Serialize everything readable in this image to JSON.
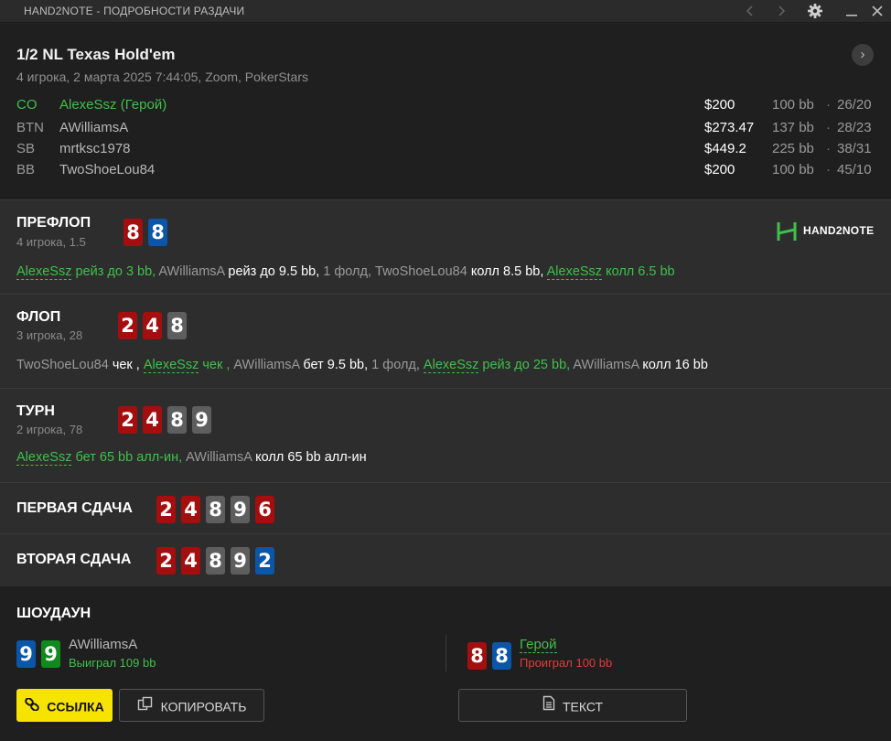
{
  "titlebar": {
    "title": "HAND2NOTE - ПОДРОБНОСТИ РАЗДАЧИ",
    "icons": [
      "chevron-left-icon",
      "chevron-right-icon",
      "gear-icon",
      "minimize-icon",
      "close-icon"
    ]
  },
  "header": {
    "game_title": "1/2 NL Texas Hold'em",
    "subtitle": "4 игрока, 2 марта 2025 7:44:05, Zoom, PokerStars",
    "next_glyph": "›",
    "players": [
      {
        "pos": "CO",
        "name": "AlexeSsz (Герой)",
        "stack": "$200",
        "bb": "100 bb",
        "dot": "·",
        "stat": "26/20",
        "hero": true
      },
      {
        "pos": "BTN",
        "name": "AWilliamsA",
        "stack": "$273.47",
        "bb": "137 bb",
        "dot": "·",
        "stat": "28/23",
        "hero": false
      },
      {
        "pos": "SB",
        "name": "mrtksc1978",
        "stack": "$449.2",
        "bb": "225 bb",
        "dot": "·",
        "stat": "38/31",
        "hero": false
      },
      {
        "pos": "BB",
        "name": "TwoShoeLou84",
        "stack": "$200",
        "bb": "100 bb",
        "dot": "·",
        "stat": "45/10",
        "hero": false
      }
    ]
  },
  "logo": {
    "text": "HAND2NOTE"
  },
  "streets": {
    "preflop": {
      "name": "ПРЕФЛОП",
      "info": "4 игрока, 1.5",
      "cards": [
        {
          "rank": "8",
          "suit": "red"
        },
        {
          "rank": "8",
          "suit": "blue"
        }
      ],
      "actions": [
        {
          "t": "AlexeSsz",
          "c": "gu"
        },
        {
          "t": " рейз до 3 bb, ",
          "c": "g"
        },
        {
          "t": "AWilliamsA ",
          "c": ""
        },
        {
          "t": "рейз до 9.5 bb, ",
          "c": "w"
        },
        {
          "t": "1 фолд, TwoShoeLou84 ",
          "c": ""
        },
        {
          "t": "колл 8.5 bb, ",
          "c": "w"
        },
        {
          "t": "AlexeSsz",
          "c": "gu"
        },
        {
          "t": " колл 6.5 bb",
          "c": "g"
        }
      ]
    },
    "flop": {
      "name": "ФЛОП",
      "info": "3 игрока, 28",
      "cards": [
        {
          "rank": "2",
          "suit": "red"
        },
        {
          "rank": "4",
          "suit": "red"
        },
        {
          "rank": "8",
          "suit": "gray"
        }
      ],
      "actions": [
        {
          "t": "TwoShoeLou84 ",
          "c": ""
        },
        {
          "t": "чек , ",
          "c": "w"
        },
        {
          "t": "AlexeSsz",
          "c": "gu"
        },
        {
          "t": " чек , ",
          "c": "g"
        },
        {
          "t": "AWilliamsA ",
          "c": ""
        },
        {
          "t": "бет 9.5 bb, ",
          "c": "w"
        },
        {
          "t": "1 фолд, ",
          "c": ""
        },
        {
          "t": "AlexeSsz",
          "c": "gu"
        },
        {
          "t": " рейз до 25 bb, ",
          "c": "g"
        },
        {
          "t": "AWilliamsA ",
          "c": ""
        },
        {
          "t": "колл 16 bb",
          "c": "w"
        }
      ]
    },
    "turn": {
      "name": "ТУРН",
      "info": "2 игрока, 78",
      "cards": [
        {
          "rank": "2",
          "suit": "red"
        },
        {
          "rank": "4",
          "suit": "red"
        },
        {
          "rank": "8",
          "suit": "gray"
        },
        {
          "rank": "9",
          "suit": "gray"
        }
      ],
      "actions": [
        {
          "t": "AlexeSsz",
          "c": "gu"
        },
        {
          "t": " бет 65 bb алл-ин, ",
          "c": "g"
        },
        {
          "t": "AWilliamsA ",
          "c": ""
        },
        {
          "t": "колл 65 bb алл-ин",
          "c": "w"
        }
      ]
    },
    "run1": {
      "name": "ПЕРВАЯ СДАЧА",
      "cards": [
        {
          "rank": "2",
          "suit": "red"
        },
        {
          "rank": "4",
          "suit": "red"
        },
        {
          "rank": "8",
          "suit": "gray"
        },
        {
          "rank": "9",
          "suit": "gray"
        },
        {
          "rank": "6",
          "suit": "red"
        }
      ]
    },
    "run2": {
      "name": "ВТОРАЯ СДАЧА",
      "cards": [
        {
          "rank": "2",
          "suit": "red"
        },
        {
          "rank": "4",
          "suit": "red"
        },
        {
          "rank": "8",
          "suit": "gray"
        },
        {
          "rank": "9",
          "suit": "gray"
        },
        {
          "rank": "2",
          "suit": "blue"
        }
      ]
    }
  },
  "showdown": {
    "title": "ШОУДАУН",
    "villain": {
      "name": "AWilliamsA",
      "result": "Выиграл 109 bb",
      "cards": [
        {
          "rank": "9",
          "suit": "blue"
        },
        {
          "rank": "9",
          "suit": "green"
        }
      ]
    },
    "hero": {
      "name": "Герой",
      "result": "Проиграл 100 bb",
      "cards": [
        {
          "rank": "8",
          "suit": "red"
        },
        {
          "rank": "8",
          "suit": "blue"
        }
      ]
    }
  },
  "buttons": {
    "link": "ССЫЛКА",
    "copy": "КОПИРОВАТЬ",
    "text": "ТЕКСТ"
  },
  "colors": {
    "hero_green": "#3fc04b",
    "lose_red": "#e33a3a",
    "card_red": "#a50e0e",
    "card_blue": "#0b56a8",
    "card_gray": "#5e5e5e",
    "card_green": "#108a1c",
    "button_yellow": "#f7e300"
  }
}
